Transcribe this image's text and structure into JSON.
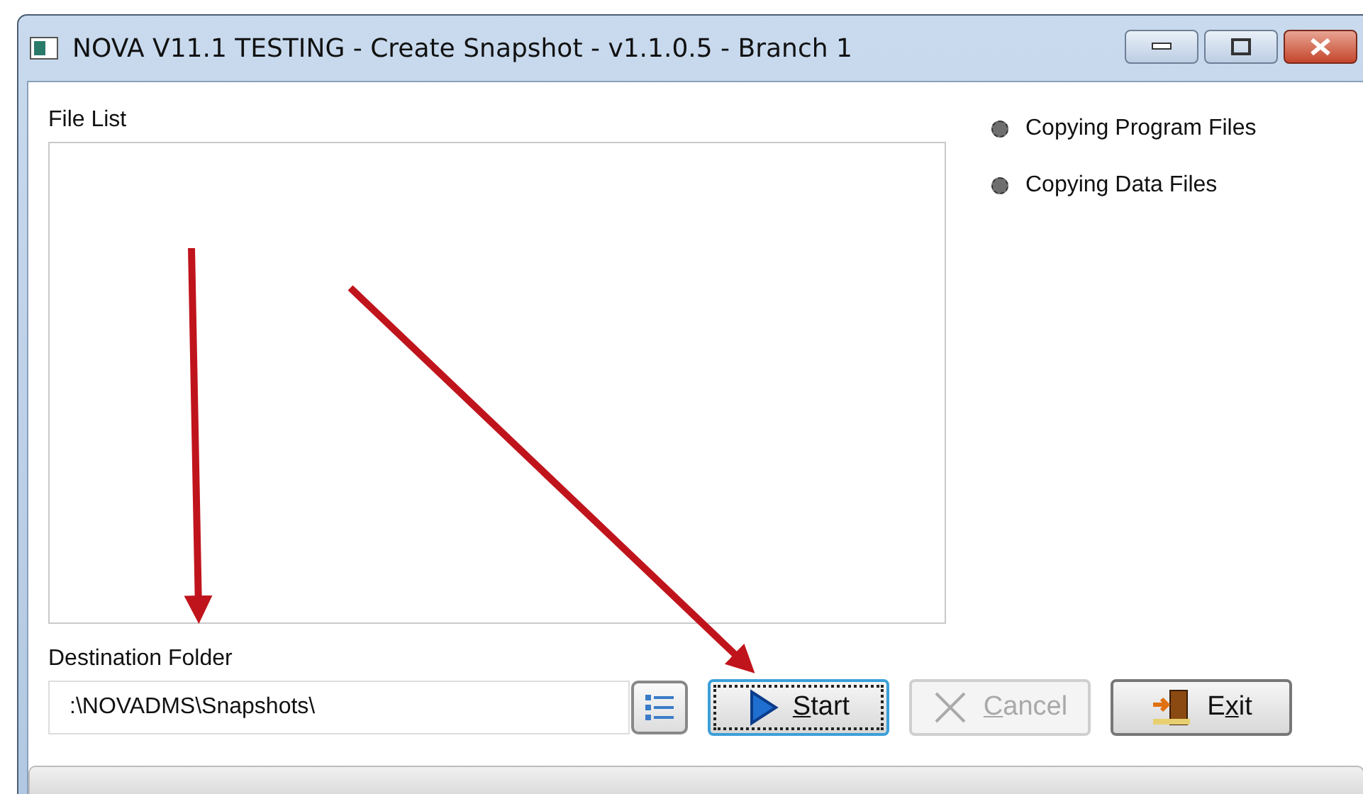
{
  "window": {
    "title": "NOVA V11.1 TESTING - Create Snapshot - v1.1.0.5 - Branch 1"
  },
  "file_list": {
    "label": "File List"
  },
  "progress_steps": [
    {
      "label": "Copying Program Files",
      "active": false
    },
    {
      "label": "Copying Data Files",
      "active": false
    }
  ],
  "destination": {
    "label": "Destination Folder",
    "value": ":\\NOVADMS\\Snapshots\\"
  },
  "buttons": [
    {
      "kind": "start",
      "key": "S",
      "post": "tart",
      "focused": true,
      "disabled": false
    },
    {
      "kind": "cancel",
      "key": "C",
      "post": "ancel",
      "focused": false,
      "disabled": true
    },
    {
      "kind": "exit",
      "pre": "E",
      "key": "x",
      "post": "it",
      "focused": false,
      "disabled": false
    }
  ]
}
